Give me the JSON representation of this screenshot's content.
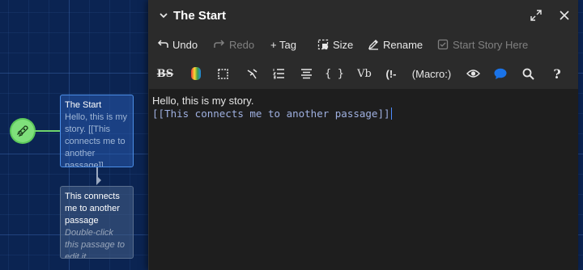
{
  "map": {
    "passages": [
      {
        "title": "The Start",
        "excerpt": "Hello, this is my story. [[This connects me to another passage]]"
      },
      {
        "title": "This connects me to another passage",
        "excerpt": "Double-click this passage to edit it."
      }
    ]
  },
  "dialog": {
    "title": "The Start",
    "toolbar": {
      "undo": "Undo",
      "redo": "Redo",
      "tag": "+ Tag",
      "size": "Size",
      "rename": "Rename",
      "start_story_here": "Start Story Here"
    },
    "format_toolbar": {
      "bold_strike": "BS",
      "verbatim": "Vb",
      "comment": "(!-",
      "macro": "(Macro:)",
      "help": "?",
      "colors": {
        "accent": "#1a73e8",
        "start": "#7fe07b"
      }
    },
    "editor": {
      "line1": "Hello, this is my story.",
      "line2": "[[This connects me to another passage]]"
    }
  }
}
